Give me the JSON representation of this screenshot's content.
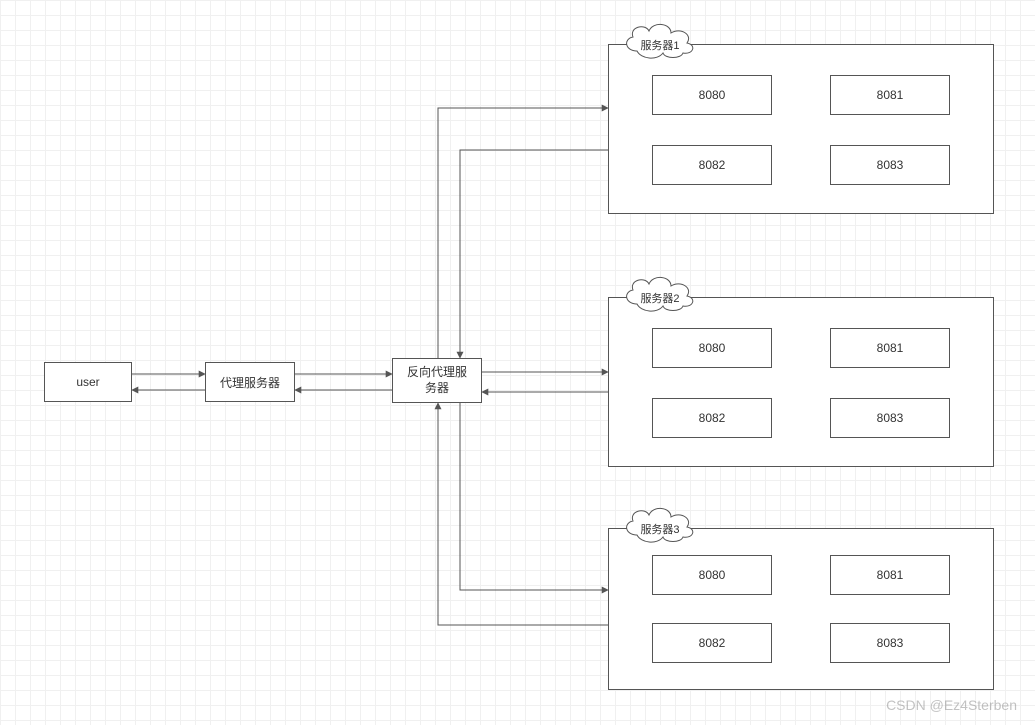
{
  "nodes": {
    "user": "user",
    "proxy": "代理服务器",
    "reverse_proxy": "反向代理服\n务器"
  },
  "servers": [
    {
      "label": "服务器1",
      "ports": [
        "8080",
        "8081",
        "8082",
        "8083"
      ]
    },
    {
      "label": "服务器2",
      "ports": [
        "8080",
        "8081",
        "8082",
        "8083"
      ]
    },
    {
      "label": "服务器3",
      "ports": [
        "8080",
        "8081",
        "8082",
        "8083"
      ]
    }
  ],
  "watermark": "CSDN @Ez4Sterben"
}
